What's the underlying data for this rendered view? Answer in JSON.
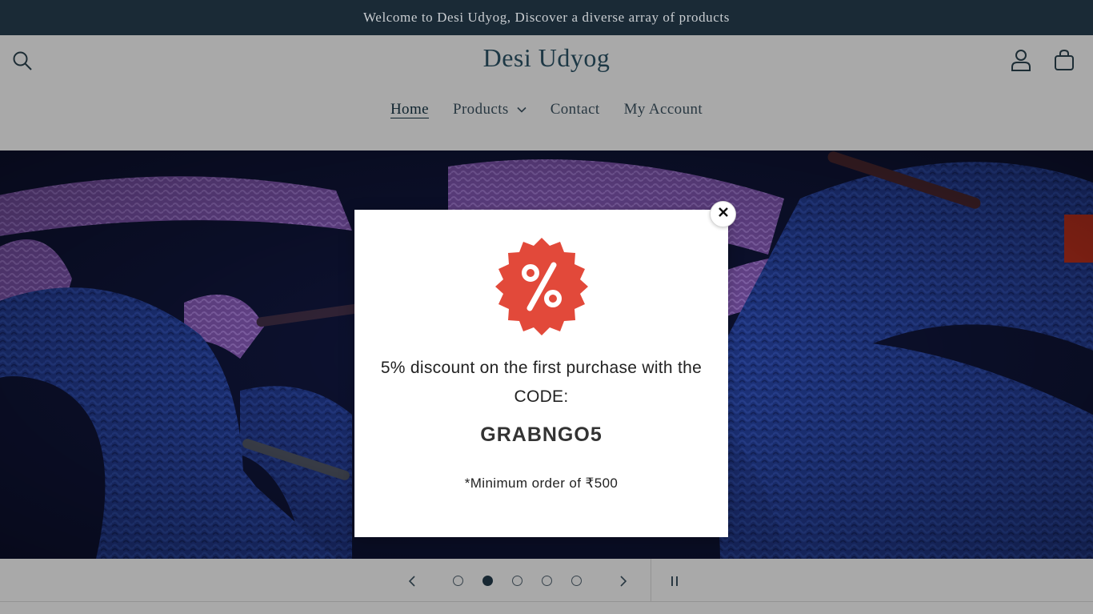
{
  "announcement": "Welcome to Desi Udyog, Discover a diverse array of products",
  "header": {
    "logo": "Desi Udyog",
    "search_icon": "search-icon",
    "account_icon": "account-icon",
    "cart_icon": "cart-icon"
  },
  "nav": {
    "items": [
      {
        "label": "Home",
        "active": true
      },
      {
        "label": "Products",
        "dropdown": true
      },
      {
        "label": "Contact"
      },
      {
        "label": "My Account"
      }
    ]
  },
  "hero": {
    "image": "close-up of tangled blue and purple shoelaces"
  },
  "popup": {
    "badge_icon": "percent-badge-icon",
    "message": "5% discount on the first purchase with the CODE:",
    "code": "GRABNGO5",
    "note": "*Minimum order of ₹500",
    "close_icon": "close-icon"
  },
  "slider": {
    "slide_count": 5,
    "current_slide": 2,
    "prev_icon": "chevron-left-icon",
    "next_icon": "chevron-right-icon",
    "pause_icon": "pause-icon"
  },
  "colors": {
    "announcement_bg": "#1a2a36",
    "header_bg": "#b0b0b0",
    "badge_red": "#e2493a",
    "text_dark": "#1f3b48"
  }
}
